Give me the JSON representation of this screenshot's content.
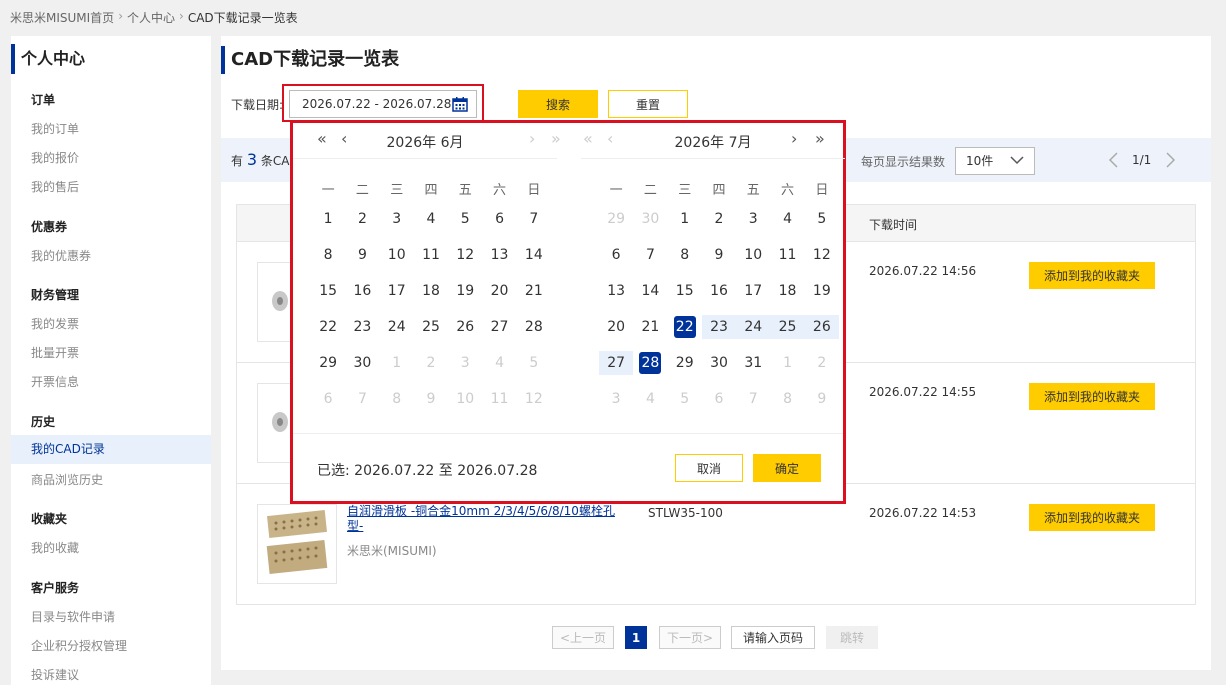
{
  "breadcrumb": [
    "米思米MISUMI首页",
    "个人中心",
    "CAD下载记录一览表"
  ],
  "sidebar": {
    "title": "个人中心",
    "groups": [
      {
        "label": "订单",
        "items": [
          "我的订单",
          "我的报价",
          "我的售后"
        ]
      },
      {
        "label": "优惠券",
        "items": [
          "我的优惠券"
        ]
      },
      {
        "label": "财务管理",
        "items": [
          "我的发票",
          "批量开票",
          "开票信息"
        ]
      },
      {
        "label": "历史",
        "items": [
          "我的CAD记录",
          "商品浏览历史"
        ]
      },
      {
        "label": "收藏夹",
        "items": [
          "我的收藏"
        ]
      },
      {
        "label": "客户服务",
        "items": [
          "目录与软件申请",
          "企业积分授权管理",
          "投诉建议"
        ]
      }
    ],
    "active": "我的CAD记录"
  },
  "page": {
    "title": "CAD下载记录一览表",
    "date_label": "下载日期:",
    "date_value": "2026.07.22 - 2026.07.28",
    "search_label": "搜索",
    "reset_label": "重置"
  },
  "results": {
    "prefix": "有",
    "count": "3",
    "suffix": "条CAD",
    "per_page_label": "每页显示结果数",
    "per_page_value": "10件",
    "page_info": "1/1"
  },
  "table": {
    "headers": {
      "time": "下载时间"
    },
    "rows": [
      {
        "name": "",
        "brand": "",
        "code": "",
        "time": "2026.07.22 14:56",
        "fav": "添加到我的收藏夹"
      },
      {
        "name": "",
        "brand": "",
        "code": "",
        "time": "2026.07.22 14:55",
        "fav": "添加到我的收藏夹"
      },
      {
        "name": "自润滑滑板 -铜合金10mm 2/3/4/5/6/8/10螺栓孔型-",
        "brand": "米思米(MISUMI)",
        "code": "STLW35-100",
        "time": "2026.07.22 14:53",
        "fav": "添加到我的收藏夹"
      }
    ]
  },
  "pager": {
    "prev": "<上一页",
    "current": "1",
    "next": "下一页>",
    "input": "请输入页码",
    "go": "跳转"
  },
  "calendar": {
    "weekdays": [
      "一",
      "二",
      "三",
      "四",
      "五",
      "六",
      "日"
    ],
    "left": {
      "title": "2026年  6月",
      "weeks": [
        [
          "1",
          "2",
          "3",
          "4",
          "5",
          "6",
          "7"
        ],
        [
          "8",
          "9",
          "10",
          "11",
          "12",
          "13",
          "14"
        ],
        [
          "15",
          "16",
          "17",
          "18",
          "19",
          "20",
          "21"
        ],
        [
          "22",
          "23",
          "24",
          "25",
          "26",
          "27",
          "28"
        ],
        [
          "29",
          "30",
          "1",
          "2",
          "3",
          "4",
          "5"
        ],
        [
          "6",
          "7",
          "8",
          "9",
          "10",
          "11",
          "12"
        ]
      ]
    },
    "right": {
      "title": "2026年  7月",
      "weeks": [
        [
          "29",
          "30",
          "1",
          "2",
          "3",
          "4",
          "5"
        ],
        [
          "6",
          "7",
          "8",
          "9",
          "10",
          "11",
          "12"
        ],
        [
          "13",
          "14",
          "15",
          "16",
          "17",
          "18",
          "19"
        ],
        [
          "20",
          "21",
          "22",
          "23",
          "24",
          "25",
          "26"
        ],
        [
          "27",
          "28",
          "29",
          "30",
          "31",
          "1",
          "2"
        ],
        [
          "3",
          "4",
          "5",
          "6",
          "7",
          "8",
          "9"
        ]
      ]
    },
    "nav": {
      "prev_year": "«",
      "prev_month": "‹",
      "next_month": "›",
      "next_year": "»"
    },
    "selected_text": "已选: 2026.07.22 至 2026.07.28",
    "cancel_label": "取消",
    "ok_label": "确定"
  },
  "colors": {
    "brand": "#003399",
    "accent": "#ffcc00",
    "alert": "#d9101f"
  }
}
